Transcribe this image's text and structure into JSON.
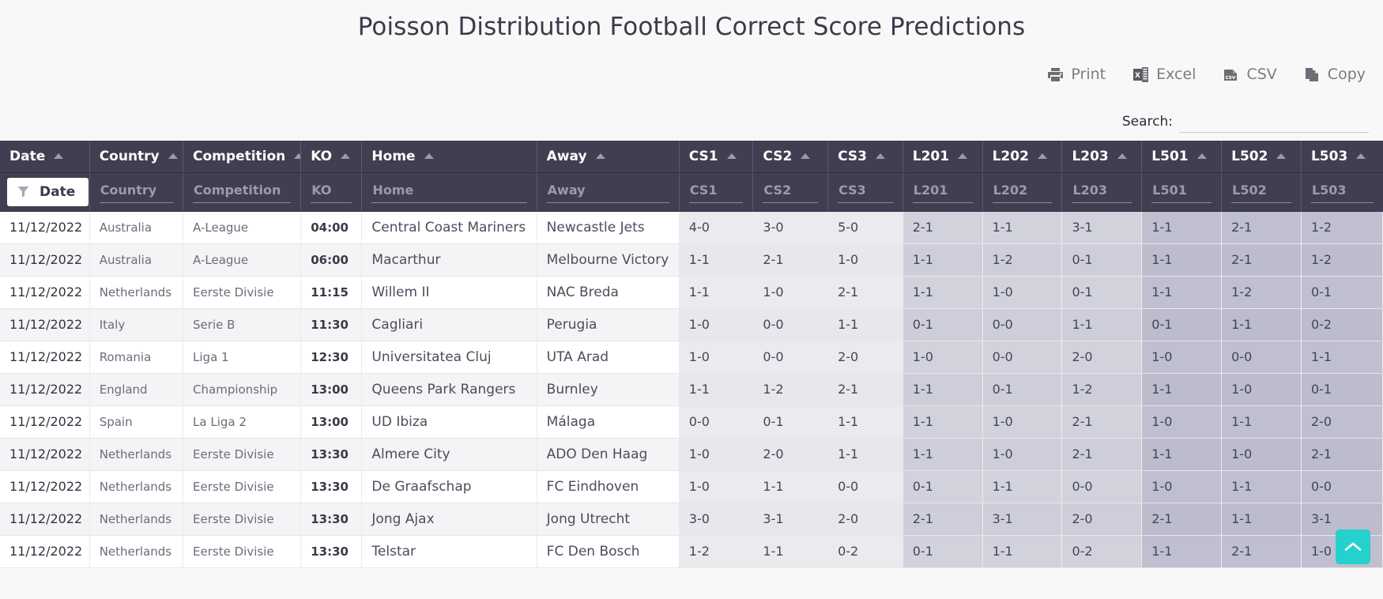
{
  "page": {
    "title": "Poisson Distribution Football Correct Score Predictions",
    "accent_color": "#25d1cd",
    "header_bg": "#3f3f51"
  },
  "toolbar": {
    "buttons": [
      {
        "label": "Print",
        "icon": "print-icon"
      },
      {
        "label": "Excel",
        "icon": "excel-icon"
      },
      {
        "label": "CSV",
        "icon": "csv-icon"
      },
      {
        "label": "Copy",
        "icon": "copy-icon"
      }
    ]
  },
  "search": {
    "label": "Search:",
    "value": "",
    "placeholder": ""
  },
  "table": {
    "columns": [
      {
        "key": "date",
        "label": "Date",
        "filter": "Date",
        "group": "info"
      },
      {
        "key": "country",
        "label": "Country",
        "filter": "Country",
        "group": "info"
      },
      {
        "key": "competition",
        "label": "Competition",
        "filter": "Competition",
        "group": "info"
      },
      {
        "key": "ko",
        "label": "KO",
        "filter": "KO",
        "group": "info"
      },
      {
        "key": "home",
        "label": "Home",
        "filter": "Home",
        "group": "info"
      },
      {
        "key": "away",
        "label": "Away",
        "filter": "Away",
        "group": "info"
      },
      {
        "key": "cs1",
        "label": "CS1",
        "filter": "CS1",
        "group": "cs"
      },
      {
        "key": "cs2",
        "label": "CS2",
        "filter": "CS2",
        "group": "cs"
      },
      {
        "key": "cs3",
        "label": "CS3",
        "filter": "CS3",
        "group": "cs"
      },
      {
        "key": "l201",
        "label": "L201",
        "filter": "L201",
        "group": "l2"
      },
      {
        "key": "l202",
        "label": "L202",
        "filter": "L202",
        "group": "l2"
      },
      {
        "key": "l203",
        "label": "L203",
        "filter": "L203",
        "group": "l2"
      },
      {
        "key": "l501",
        "label": "L501",
        "filter": "L501",
        "group": "l5"
      },
      {
        "key": "l502",
        "label": "L502",
        "filter": "L502",
        "group": "l5"
      },
      {
        "key": "l503",
        "label": "L503",
        "filter": "L503",
        "group": "l5"
      }
    ],
    "sort_indicator": "ascending",
    "date_filter_active": true,
    "rows": [
      {
        "date": "11/12/2022",
        "country": "Australia",
        "competition": "A-League",
        "ko": "04:00",
        "home": "Central Coast Mariners",
        "away": "Newcastle Jets",
        "cs1": "4-0",
        "cs2": "3-0",
        "cs3": "5-0",
        "l201": "2-1",
        "l202": "1-1",
        "l203": "3-1",
        "l501": "1-1",
        "l502": "2-1",
        "l503": "1-2"
      },
      {
        "date": "11/12/2022",
        "country": "Australia",
        "competition": "A-League",
        "ko": "06:00",
        "home": "Macarthur",
        "away": "Melbourne Victory",
        "cs1": "1-1",
        "cs2": "2-1",
        "cs3": "1-0",
        "l201": "1-1",
        "l202": "1-2",
        "l203": "0-1",
        "l501": "1-1",
        "l502": "2-1",
        "l503": "1-2"
      },
      {
        "date": "11/12/2022",
        "country": "Netherlands",
        "competition": "Eerste Divisie",
        "ko": "11:15",
        "home": "Willem II",
        "away": "NAC Breda",
        "cs1": "1-1",
        "cs2": "1-0",
        "cs3": "2-1",
        "l201": "1-1",
        "l202": "1-0",
        "l203": "0-1",
        "l501": "1-1",
        "l502": "1-2",
        "l503": "0-1"
      },
      {
        "date": "11/12/2022",
        "country": "Italy",
        "competition": "Serie B",
        "ko": "11:30",
        "home": "Cagliari",
        "away": "Perugia",
        "cs1": "1-0",
        "cs2": "0-0",
        "cs3": "1-1",
        "l201": "0-1",
        "l202": "0-0",
        "l203": "1-1",
        "l501": "0-1",
        "l502": "1-1",
        "l503": "0-2"
      },
      {
        "date": "11/12/2022",
        "country": "Romania",
        "competition": "Liga 1",
        "ko": "12:30",
        "home": "Universitatea Cluj",
        "away": "UTA Arad",
        "cs1": "1-0",
        "cs2": "0-0",
        "cs3": "2-0",
        "l201": "1-0",
        "l202": "0-0",
        "l203": "2-0",
        "l501": "1-0",
        "l502": "0-0",
        "l503": "1-1"
      },
      {
        "date": "11/12/2022",
        "country": "England",
        "competition": "Championship",
        "ko": "13:00",
        "home": "Queens Park Rangers",
        "away": "Burnley",
        "cs1": "1-1",
        "cs2": "1-2",
        "cs3": "2-1",
        "l201": "1-1",
        "l202": "0-1",
        "l203": "1-2",
        "l501": "1-1",
        "l502": "1-0",
        "l503": "0-1"
      },
      {
        "date": "11/12/2022",
        "country": "Spain",
        "competition": "La Liga 2",
        "ko": "13:00",
        "home": "UD Ibiza",
        "away": "Málaga",
        "cs1": "0-0",
        "cs2": "0-1",
        "cs3": "1-1",
        "l201": "1-1",
        "l202": "1-0",
        "l203": "2-1",
        "l501": "1-0",
        "l502": "1-1",
        "l503": "2-0"
      },
      {
        "date": "11/12/2022",
        "country": "Netherlands",
        "competition": "Eerste Divisie",
        "ko": "13:30",
        "home": "Almere City",
        "away": "ADO Den Haag",
        "cs1": "1-0",
        "cs2": "2-0",
        "cs3": "1-1",
        "l201": "1-1",
        "l202": "1-0",
        "l203": "2-1",
        "l501": "1-1",
        "l502": "1-0",
        "l503": "2-1"
      },
      {
        "date": "11/12/2022",
        "country": "Netherlands",
        "competition": "Eerste Divisie",
        "ko": "13:30",
        "home": "De Graafschap",
        "away": "FC Eindhoven",
        "cs1": "1-0",
        "cs2": "1-1",
        "cs3": "0-0",
        "l201": "0-1",
        "l202": "1-1",
        "l203": "0-0",
        "l501": "1-0",
        "l502": "1-1",
        "l503": "0-0"
      },
      {
        "date": "11/12/2022",
        "country": "Netherlands",
        "competition": "Eerste Divisie",
        "ko": "13:30",
        "home": "Jong Ajax",
        "away": "Jong Utrecht",
        "cs1": "3-0",
        "cs2": "3-1",
        "cs3": "2-0",
        "l201": "2-1",
        "l202": "3-1",
        "l203": "2-0",
        "l501": "2-1",
        "l502": "1-1",
        "l503": "3-1"
      },
      {
        "date": "11/12/2022",
        "country": "Netherlands",
        "competition": "Eerste Divisie",
        "ko": "13:30",
        "home": "Telstar",
        "away": "FC Den Bosch",
        "cs1": "1-2",
        "cs2": "1-1",
        "cs3": "0-2",
        "l201": "0-1",
        "l202": "1-1",
        "l203": "0-2",
        "l501": "1-1",
        "l502": "2-1",
        "l503": "1-0"
      }
    ]
  },
  "scroll_top": {
    "label": "Scroll to top",
    "icon": "chevron-up-icon"
  }
}
